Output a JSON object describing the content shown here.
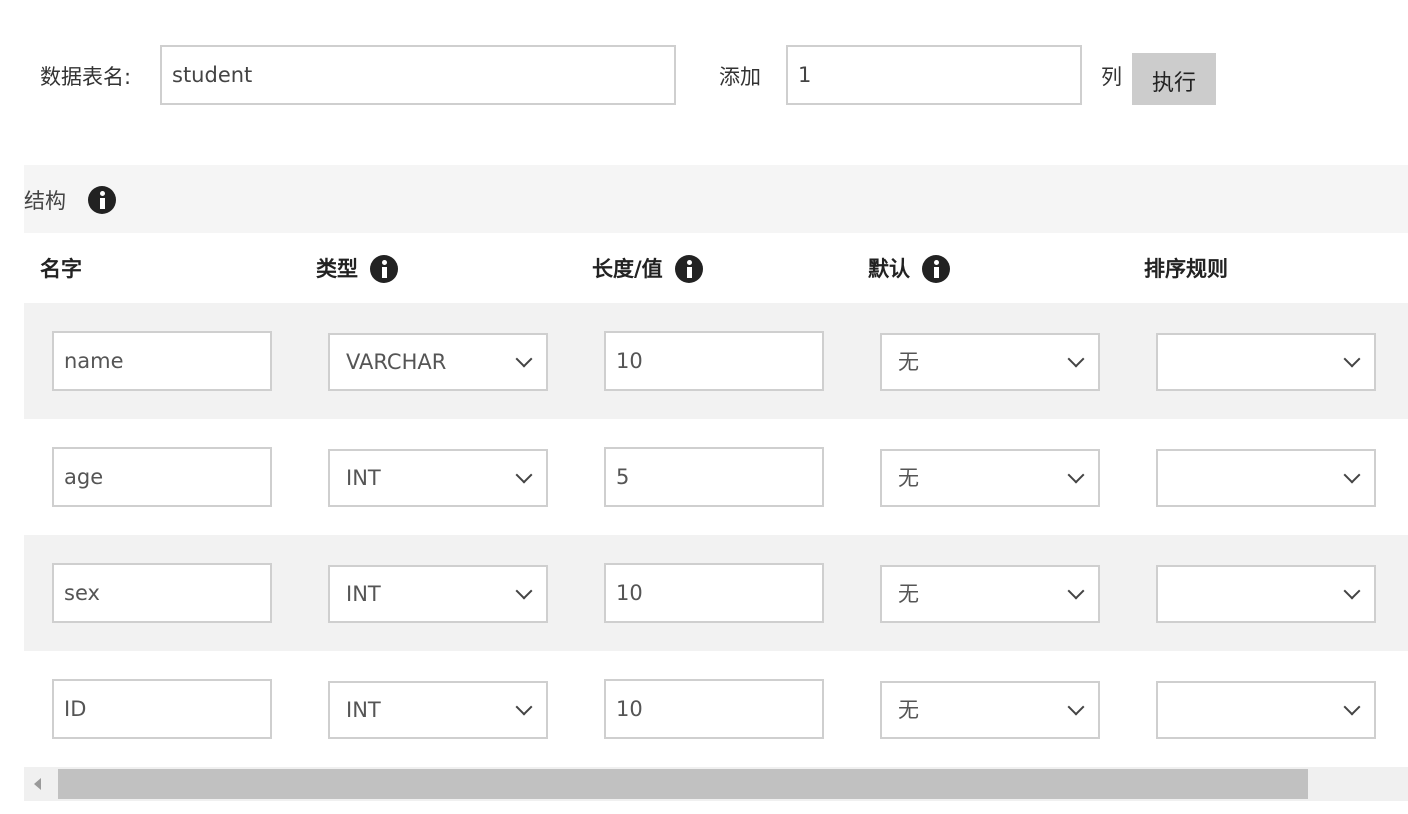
{
  "toolbar": {
    "table_name_label": "数据表名:",
    "table_name_value": "student",
    "add_label": "添加",
    "add_count_value": "1",
    "column_unit": "列",
    "execute_label": "执行"
  },
  "structure": {
    "title": "结构"
  },
  "columns": {
    "name": "名字",
    "type": "类型",
    "length": "长度/值",
    "default": "默认",
    "collation": "排序规则"
  },
  "rows": [
    {
      "name": "name",
      "type": "VARCHAR",
      "length": "10",
      "default": "无",
      "collation": ""
    },
    {
      "name": "age",
      "type": "INT",
      "length": "5",
      "default": "无",
      "collation": ""
    },
    {
      "name": "sex",
      "type": "INT",
      "length": "10",
      "default": "无",
      "collation": ""
    },
    {
      "name": "ID",
      "type": "INT",
      "length": "10",
      "default": "无",
      "collation": ""
    }
  ],
  "icons": {
    "info": "info-icon",
    "dropdown": "chevron-down-icon",
    "scroll_left": "scroll-left-arrow-icon"
  },
  "colors": {
    "header_bar": "#f5f5f5",
    "alt_row": "#f2f2f2",
    "button_bg": "#cccccc",
    "scroll_thumb": "#c1c1c1"
  }
}
